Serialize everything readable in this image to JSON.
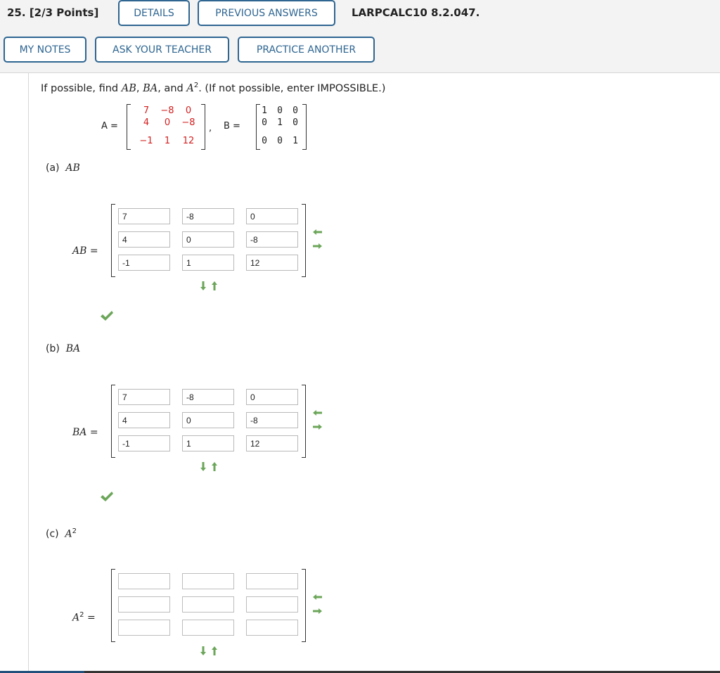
{
  "header": {
    "question_number": "25.",
    "points": "[2/3 Points]",
    "details_label": "DETAILS",
    "previous_answers_label": "PREVIOUS ANSWERS",
    "reference": "LARPCALC10 8.2.047.",
    "my_notes_label": "MY NOTES",
    "ask_teacher_label": "ASK YOUR TEACHER",
    "practice_another_label": "PRACTICE ANOTHER"
  },
  "prompt": {
    "lead": "If possible, find ",
    "ab": "AB",
    "sep1": ", ",
    "ba": "BA",
    "sep2": ", and ",
    "a": "A",
    "exp": "2",
    "tail": ". (If not possible, enter IMPOSSIBLE.)"
  },
  "given": {
    "a_label": "A =",
    "comma": ",",
    "b_label": "B =",
    "matrix_a": [
      [
        "7",
        "−8",
        "0"
      ],
      [
        "4",
        "0",
        "−8"
      ],
      [
        "−1",
        "1",
        "12"
      ]
    ],
    "matrix_b": [
      [
        "1",
        "0",
        "0"
      ],
      [
        "0",
        "1",
        "0"
      ],
      [
        "0",
        "0",
        "1"
      ]
    ]
  },
  "parts": {
    "a": {
      "title_prefix": "(a)",
      "title": "AB",
      "eq_label": "AB",
      "eq_sign": "=",
      "values": [
        [
          "7",
          "-8",
          "0"
        ],
        [
          "4",
          "0",
          "-8"
        ],
        [
          "-1",
          "1",
          "12"
        ]
      ],
      "status": "correct"
    },
    "b": {
      "title_prefix": "(b)",
      "title": "BA",
      "eq_label": "BA",
      "eq_sign": "=",
      "values": [
        [
          "7",
          "-8",
          "0"
        ],
        [
          "4",
          "0",
          "-8"
        ],
        [
          "-1",
          "1",
          "12"
        ]
      ],
      "status": "correct"
    },
    "c": {
      "title_prefix": "(c)",
      "title": "A",
      "title_exp": "2",
      "eq_label": "A",
      "eq_exp": "2",
      "eq_sign": "=",
      "values": [
        [
          "",
          "",
          ""
        ],
        [
          "",
          "",
          ""
        ],
        [
          "",
          "",
          ""
        ]
      ],
      "status": "unanswered"
    }
  },
  "colors": {
    "button_blue": "#2e6591",
    "header_bg": "#f3f3f3",
    "matrix_red": "#d32020",
    "arrow_green": "#6ca65a",
    "check_green": "#6ca65a"
  },
  "icons": {
    "add_remove_column": "left-right-arrows-icon",
    "add_remove_row": "down-up-arrows-icon",
    "correct": "green-checkmark-icon"
  }
}
